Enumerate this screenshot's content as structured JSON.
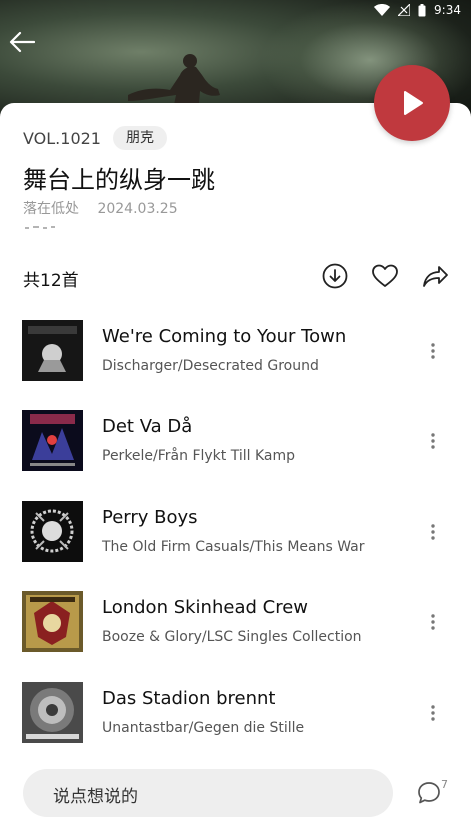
{
  "status_bar": {
    "time": "9:34"
  },
  "album": {
    "vol": "VOL.1021",
    "tag": "朋克",
    "title": "舞台上的纵身一跳",
    "author": "落在低处",
    "date": "2024.03.25",
    "count": "共12首"
  },
  "songs": [
    {
      "title": "We're Coming to Your Town",
      "subtitle": "Discharger/Desecrated Ground"
    },
    {
      "title": "Det Va Då",
      "subtitle": "Perkele/Från Flykt Till Kamp"
    },
    {
      "title": "Perry Boys",
      "subtitle": "The Old Firm Casuals/This Means War"
    },
    {
      "title": "London Skinhead Crew",
      "subtitle": "Booze & Glory/LSC Singles Collection"
    },
    {
      "title": "Das Stadion brennt",
      "subtitle": "Unantastbar/Gegen die Stille"
    }
  ],
  "comment": {
    "placeholder": "说点想说的",
    "count": "7"
  },
  "icons": [
    "back-arrow-icon",
    "play-icon",
    "download-icon",
    "heart-icon",
    "share-icon",
    "more-icon",
    "comment-bubble-icon",
    "wifi-icon",
    "signal-icon",
    "battery-icon"
  ],
  "colors": {
    "accent": "#c0393e"
  }
}
